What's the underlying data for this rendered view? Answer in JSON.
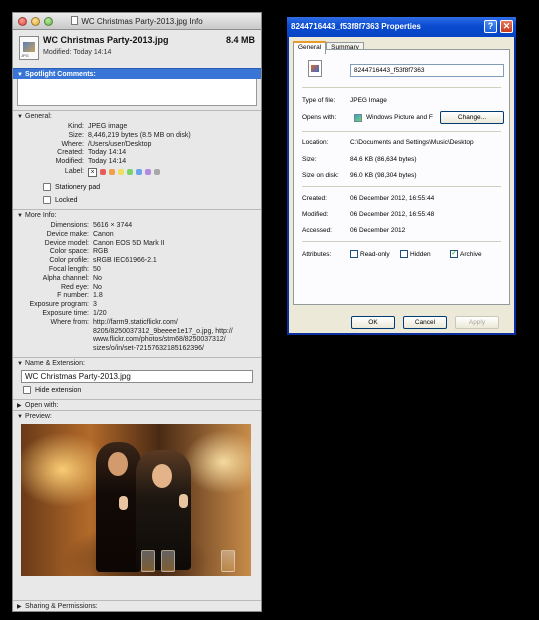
{
  "mac": {
    "title": "WC Christmas Party-2013.jpg Info",
    "file_name": "WC Christmas Party-2013.jpg",
    "file_size": "8.4 MB",
    "modified": "Modified: Today 14:14",
    "spotlight_header": "Spotlight Comments:",
    "general": {
      "header": "General:",
      "rows": [
        {
          "k": "Kind:",
          "v": "JPEG image"
        },
        {
          "k": "Size:",
          "v": "8,446,219 bytes (8.5 MB on disk)"
        },
        {
          "k": "Where:",
          "v": "/Users/user/Desktop"
        },
        {
          "k": "Created:",
          "v": "Today 14:14"
        },
        {
          "k": "Modified:",
          "v": "Today 14:14"
        }
      ],
      "label_key": "Label:",
      "label_x": "×",
      "stationery": "Stationery pad",
      "locked": "Locked"
    },
    "more_info": {
      "header": "More Info:",
      "rows": [
        {
          "k": "Dimensions:",
          "v": "5616 × 3744"
        },
        {
          "k": "Device make:",
          "v": "Canon"
        },
        {
          "k": "Device model:",
          "v": "Canon EOS 5D Mark II"
        },
        {
          "k": "Color space:",
          "v": "RGB"
        },
        {
          "k": "Color profile:",
          "v": "sRGB IEC61966-2.1"
        },
        {
          "k": "Focal length:",
          "v": "50"
        },
        {
          "k": "Alpha channel:",
          "v": "No"
        },
        {
          "k": "Red eye:",
          "v": "No"
        },
        {
          "k": "F number:",
          "v": "1.8"
        },
        {
          "k": "Exposure program:",
          "v": "3"
        },
        {
          "k": "Exposure time:",
          "v": "1/20"
        }
      ],
      "where_from_key": "Where from:",
      "where_from_lines": [
        "http://farm9.staticflickr.com/",
        "8205/8250037312_9beeee1e17_o.jpg, http://",
        "www.flickr.com/photos/stm68/8250037312/",
        "sizes/o/in/set-72157632185162396/"
      ]
    },
    "name_ext": {
      "header": "Name & Extension:",
      "value": "WC Christmas Party-2013.jpg",
      "hide_extension": "Hide extension"
    },
    "open_with_header": "Open with:",
    "preview_header": "Preview:",
    "sharing_header": "Sharing & Permissions:",
    "label_colors": [
      "#e85b5b",
      "#f0a04b",
      "#ede060",
      "#7bd36a",
      "#6ba4ea",
      "#b48ae0",
      "#a7a7a7"
    ]
  },
  "win": {
    "title": "8244716443_f53f8f7363 Properties",
    "tabs": [
      "General",
      "Summary"
    ],
    "name_value": "8244716443_f53f8f7363",
    "rows": {
      "type_k": "Type of file:",
      "type_v": "JPEG Image",
      "opens_k": "Opens with:",
      "opens_v": "Windows Picture and F",
      "change": "Change...",
      "location_k": "Location:",
      "location_v": "C:\\Documents and Settings\\Music\\Desktop",
      "size_k": "Size:",
      "size_v": "84.6 KB (86,634 bytes)",
      "disk_k": "Size on disk:",
      "disk_v": "96.0 KB (98,304 bytes)",
      "created_k": "Created:",
      "created_v": "06 December 2012, 16:55:44",
      "modified_k": "Modified:",
      "modified_v": "06 December 2012, 16:55:48",
      "accessed_k": "Accessed:",
      "accessed_v": "06 December 2012",
      "attr_k": "Attributes:",
      "readonly": "Read-only",
      "hidden": "Hidden",
      "archive": "Archive"
    },
    "ok": "OK",
    "cancel": "Cancel",
    "apply": "Apply",
    "help_glyph": "?",
    "close_glyph": "✕",
    "check_glyph": "✓"
  }
}
